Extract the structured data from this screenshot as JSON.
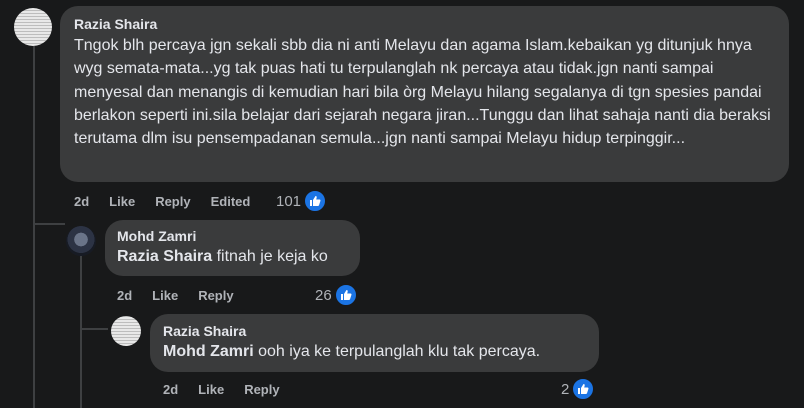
{
  "comments": [
    {
      "author": "Razia Shaira",
      "text": "Tngok blh percaya jgn sekali sbb dia ni anti Melayu dan agama Islam.kebaikan yg ditunjuk hnya wyg semata-mata...yg tak puas hati tu terpulanglah nk percaya atau tidak.jgn nanti sampai menyesal dan menangis di kemudian hari bila òrg Melayu hilang segalanya di tgn spesies pandai berlakon seperti ini.sila belajar dari sejarah negara jiran...Tunggu dan lihat sahaja nanti dia beraksi terutama dlm isu pensempadanan semula...jgn nanti sampai Melayu hidup terpinggir...",
      "time": "2d",
      "like_label": "Like",
      "reply_label": "Reply",
      "edited_label": "Edited",
      "reaction_count": "101"
    },
    {
      "author": "Mohd Zamri",
      "mention": "Razia Shaira",
      "text": " fitnah je keja ko",
      "time": "2d",
      "like_label": "Like",
      "reply_label": "Reply",
      "reaction_count": "26"
    },
    {
      "author": "Razia Shaira",
      "mention": "Mohd Zamri",
      "text": " ooh iya ke terpulanglah klu tak percaya.",
      "time": "2d",
      "like_label": "Like",
      "reply_label": "Reply",
      "reaction_count": "2"
    }
  ],
  "icons": {
    "reaction": "like-thumb-icon",
    "reaction_color": "#1b74e4"
  }
}
